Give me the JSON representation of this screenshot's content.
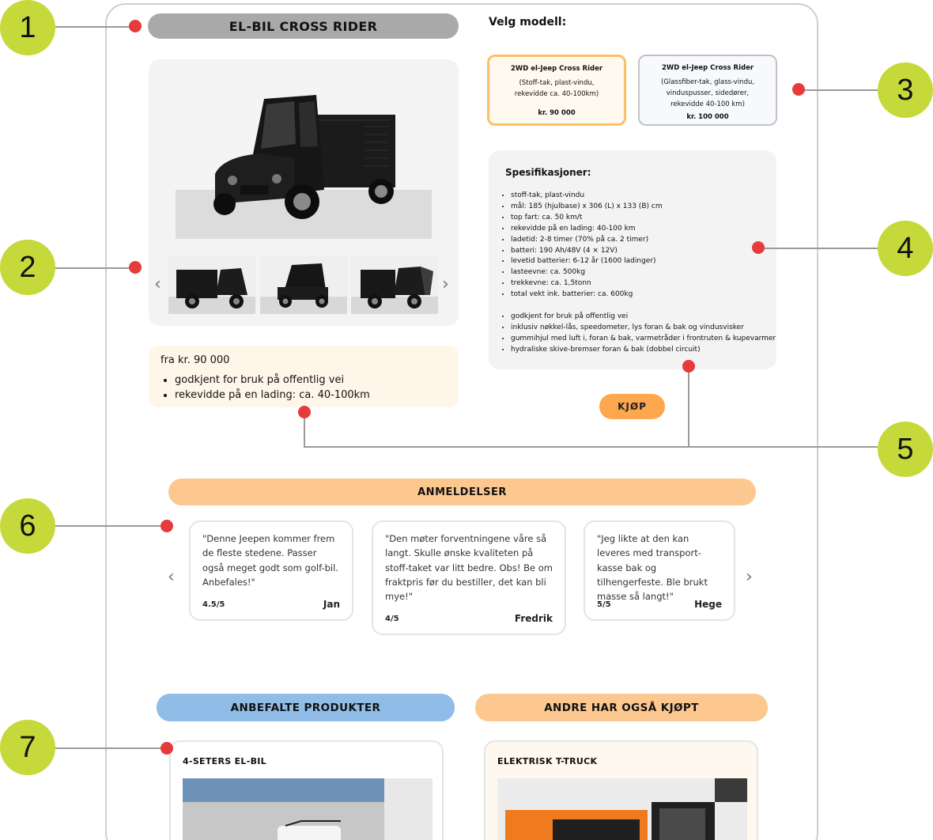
{
  "product": {
    "title": "EL-BIL CROSS RIDER",
    "price_from": "fra kr. 90 000",
    "highlights": [
      "godkjent for bruk på offentlig vei",
      "rekevidde på en lading: ca. 40-100km"
    ]
  },
  "gallery": {
    "prev_icon": "chevron-left-icon",
    "next_icon": "chevron-right-icon",
    "thumbnails": 3
  },
  "models": {
    "label": "Velg modell:",
    "options": [
      {
        "name": "2WD el-Jeep Cross Rider",
        "details": [
          "(Stoff-tak, plast-vindu,",
          "rekevidde ca. 40-100km)"
        ],
        "price": "kr. 90 000",
        "selected": true
      },
      {
        "name": "2WD el-Jeep Cross Rider",
        "details": [
          "(Glassfiber-tak, glass-vindu,",
          "vinduspusser, sidedører,",
          "rekevidde 40-100 km)"
        ],
        "price": "kr. 100 000",
        "selected": false
      }
    ]
  },
  "specs": {
    "title": "Spesifikasjoner:",
    "list1": [
      "stoff-tak, plast-vindu",
      "mål: 185 (hjulbase) x 306 (L) x 133 (B) cm",
      "top fart: ca. 50 km/t",
      "rekevidde på en lading: 40-100 km",
      "ladetid: 2-8 timer (70% på ca. 2 timer)",
      "batteri: 190 Ah/48V (4 × 12V)",
      "levetid batterier: 6-12 år (1600 ladinger)",
      "lasteevne: ca. 500kg",
      "trekkevne: ca. 1,5tonn",
      "total vekt ink. batterier: ca. 600kg"
    ],
    "list2": [
      "godkjent for bruk på offentlig vei",
      "inklusiv nøkkel-lås, speedometer, lys foran & bak og vindusvisker",
      "gummihjul med luft i, foran & bak, varmetråder i frontruten & kupevarmer",
      "hydraliske skive-bremser foran & bak (dobbel circuit)"
    ]
  },
  "buy_label": "KJØP",
  "reviews": {
    "title": "ANMELDELSER",
    "items": [
      {
        "text": "\"Denne Jeepen kommer frem de fleste stedene. Passer også meget godt som golf-bil. Anbefales!\"",
        "rating": "4.5/5",
        "author": "Jan"
      },
      {
        "text": "\"Den møter forventningene våre så langt. Skulle ønske kvaliteten på stoff-taket var litt bedre. Obs! Be om fraktpris før du bestiller, det kan bli mye!\"",
        "rating": "4/5",
        "author": "Fredrik"
      },
      {
        "text": "\"Jeg likte at den kan leveres med transport-kasse bak og tilhengerfeste. Ble brukt masse så langt!\"",
        "rating": "5/5",
        "author": "Hege"
      }
    ]
  },
  "recommended": {
    "title": "ANBEFALTE PRODUKTER",
    "product": "4-SETERS EL-BIL"
  },
  "also_bought": {
    "title": "ANDRE HAR OGSÅ KJØPT",
    "product": "ELEKTRISK T-TRUCK"
  },
  "callouts": [
    "1",
    "2",
    "3",
    "4",
    "5",
    "6",
    "7"
  ],
  "colors": {
    "badge": "#c5d93a",
    "dot": "#e53b3b",
    "accent_orange": "#fda74e",
    "reviews_bar": "#fdc88f",
    "recommended_bar": "#8fbde8",
    "also_bought_bar": "#fdc88f"
  }
}
